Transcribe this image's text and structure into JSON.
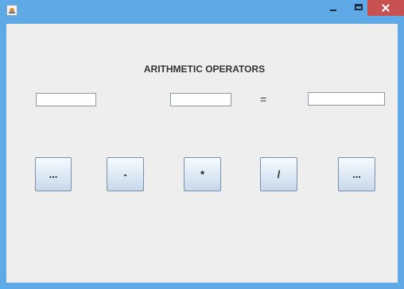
{
  "window": {
    "title": "",
    "controls": {
      "icon": "java-app-icon",
      "minimize": "minimize-icon",
      "maximize": "maximize-icon",
      "close": "close-icon"
    },
    "colors": {
      "frame": "#5fa9e6",
      "close": "#c75050",
      "content_background": "#eeeeee"
    }
  },
  "main": {
    "heading": "ARITHMETIC OPERATORS",
    "operand1": {
      "value": "",
      "placeholder": ""
    },
    "operand2": {
      "value": "",
      "placeholder": ""
    },
    "equals": "=",
    "result": {
      "value": "",
      "placeholder": ""
    },
    "buttons": [
      {
        "label": "..."
      },
      {
        "label": "-"
      },
      {
        "label": "*"
      },
      {
        "label": "/"
      },
      {
        "label": "..."
      }
    ]
  }
}
